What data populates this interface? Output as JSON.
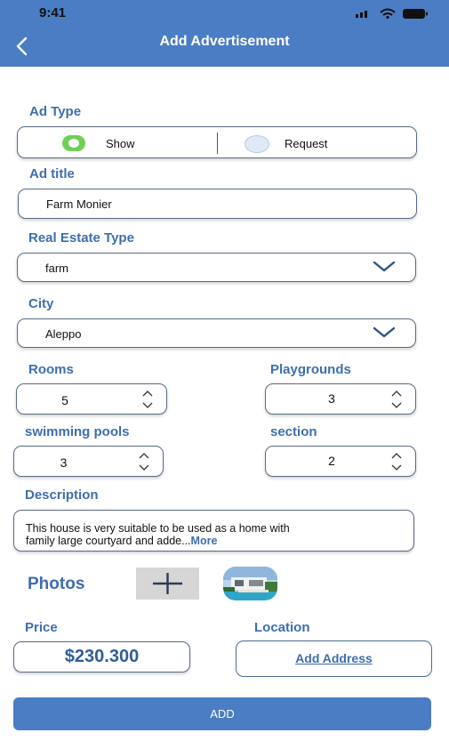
{
  "status": {
    "time": "9:41"
  },
  "header": {
    "title": "Add Advertisement"
  },
  "ad_type": {
    "label": "Ad Type",
    "options": [
      "Show",
      "Request"
    ],
    "selected": "Show"
  },
  "ad_title": {
    "label": "Ad title",
    "value": "Farm Monier"
  },
  "real_estate_type": {
    "label": "Real Estate Type",
    "value": "farm"
  },
  "city": {
    "label": "City",
    "value": "Aleppo"
  },
  "rooms": {
    "label": "Rooms",
    "value": "5"
  },
  "playgrounds": {
    "label": "Playgrounds",
    "value": "3"
  },
  "pools": {
    "label": "swimming pools",
    "value": "3"
  },
  "section": {
    "label": "section",
    "value": "2"
  },
  "description": {
    "label": "Description",
    "line1": "This house is very suitable to be used as a home with",
    "line2": "family large courtyard and adde...",
    "more": "More"
  },
  "photos": {
    "label": "Photos"
  },
  "price": {
    "label": "Price",
    "value": "$230.300"
  },
  "location": {
    "label": "Location",
    "link": "Add Address"
  },
  "submit": {
    "label": "ADD"
  },
  "colors": {
    "primary": "#4a7dc4",
    "label": "#3e6eae",
    "radio_on": "#6fcf57",
    "radio_off": "#dfe9f7"
  }
}
